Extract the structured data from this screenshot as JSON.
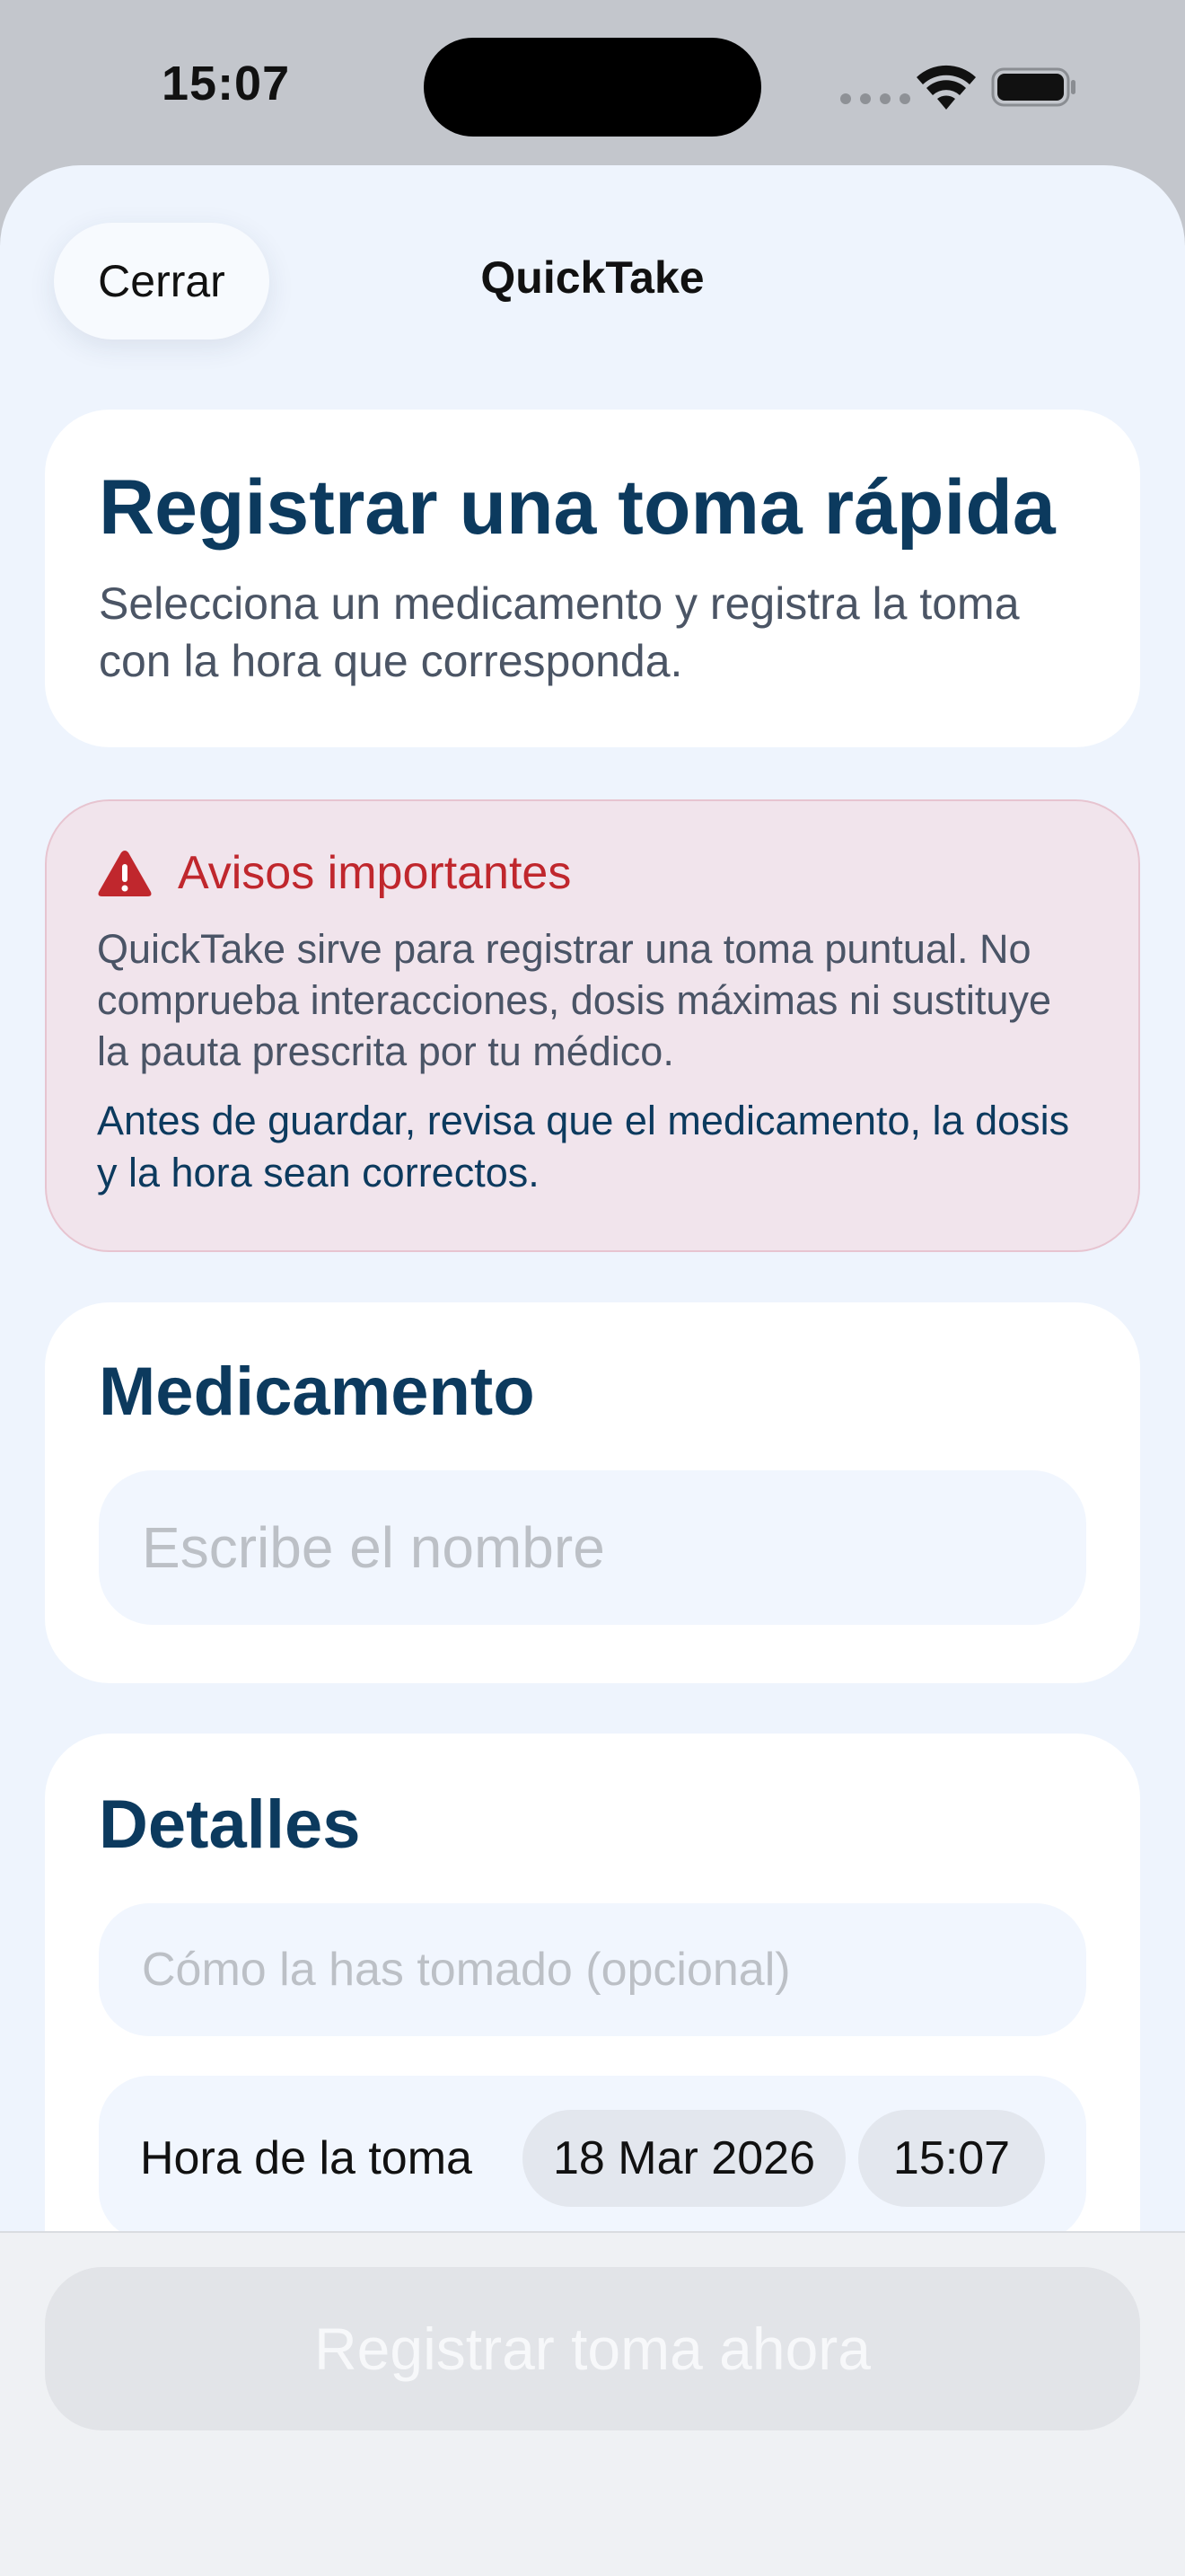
{
  "status_bar": {
    "time": "15:07"
  },
  "header": {
    "close_label": "Cerrar",
    "title": "QuickTake"
  },
  "intro": {
    "title": "Registrar una toma rápida",
    "subtitle": "Selecciona un medicamento y registra la toma con la hora que corresponda."
  },
  "warning": {
    "icon": "warning-triangle-icon",
    "title": "Avisos importantes",
    "body": "QuickTake sirve para registrar una toma puntual. No comprueba interacciones, dosis máximas ni sustituye la pauta prescrita por tu médico.",
    "note": "Antes de guardar, revisa que el medicamento, la dosis y la hora sean correctos."
  },
  "medication": {
    "title": "Medicamento",
    "placeholder": "Escribe el nombre",
    "value": ""
  },
  "details": {
    "title": "Detalles",
    "method_placeholder": "Cómo la has tomado (opcional)",
    "time_label": "Hora de la toma",
    "date_value": "18 Mar 2026",
    "time_value": "15:07"
  },
  "footer": {
    "submit_label": "Registrar toma ahora"
  },
  "colors": {
    "accent": "#0c3a5e",
    "warning": "#c0272d",
    "sheet_background": "#eef4fd",
    "disabled_button": "#e2e4e8"
  }
}
